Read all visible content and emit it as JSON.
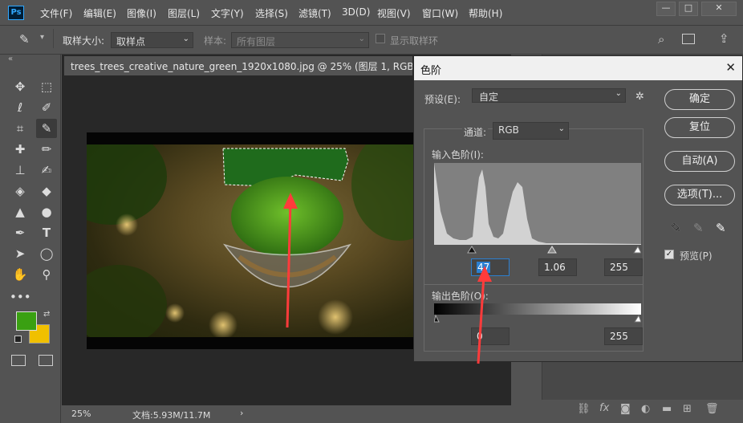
{
  "app": {
    "logo": "Ps"
  },
  "menu": [
    "文件(F)",
    "编辑(E)",
    "图像(I)",
    "图层(L)",
    "文字(Y)",
    "选择(S)",
    "滤镜(T)",
    "3D(D)",
    "视图(V)",
    "窗口(W)",
    "帮助(H)"
  ],
  "window_controls": {
    "minimize": "—",
    "restore": "□",
    "close": "✕"
  },
  "options": {
    "sample_size_label": "取样大小:",
    "sample_size_value": "取样点",
    "sample_label": "样本:",
    "sample_value": "所有图层",
    "show_ring_label": "显示取样环"
  },
  "document": {
    "tab_title": "trees_trees_creative_nature_green_1920x1080.jpg @ 25% (图层 1, RGB/8#) *",
    "zoom": "25%",
    "doc_info": "文档:5.93M/11.7M",
    "status_arrow": "›"
  },
  "levels_dialog": {
    "title": "色阶",
    "preset_label": "预设(E):",
    "preset_value": "自定",
    "channel_label": "通道:",
    "channel_value": "RGB",
    "input_levels_label": "输入色阶(I):",
    "input_black": "47",
    "input_gamma": "1.06",
    "input_white": "255",
    "output_levels_label": "输出色阶(O):",
    "output_black": "0",
    "output_white": "255",
    "ok_label": "确定",
    "reset_label": "复位",
    "auto_label": "自动(A)",
    "options_label": "选项(T)...",
    "preview_label": "预览(P)",
    "preview_checked": true
  },
  "colors": {
    "foreground": "#3aa012",
    "background": "#f0c000",
    "annotation_arrow": "#ff3b3b"
  },
  "toolbar_icons": [
    "move-icon",
    "marquee-icon",
    "lasso-icon",
    "quick-select-icon",
    "crop-icon",
    "eyedropper-icon",
    "healing-icon",
    "brush-icon",
    "stamp-icon",
    "history-brush-icon",
    "eraser-icon",
    "paint-bucket-icon",
    "sharpen-icon",
    "dodge-icon",
    "pen-icon",
    "type-icon",
    "path-select-icon",
    "ellipse-icon",
    "hand-icon",
    "zoom-icon",
    "more-icon"
  ]
}
